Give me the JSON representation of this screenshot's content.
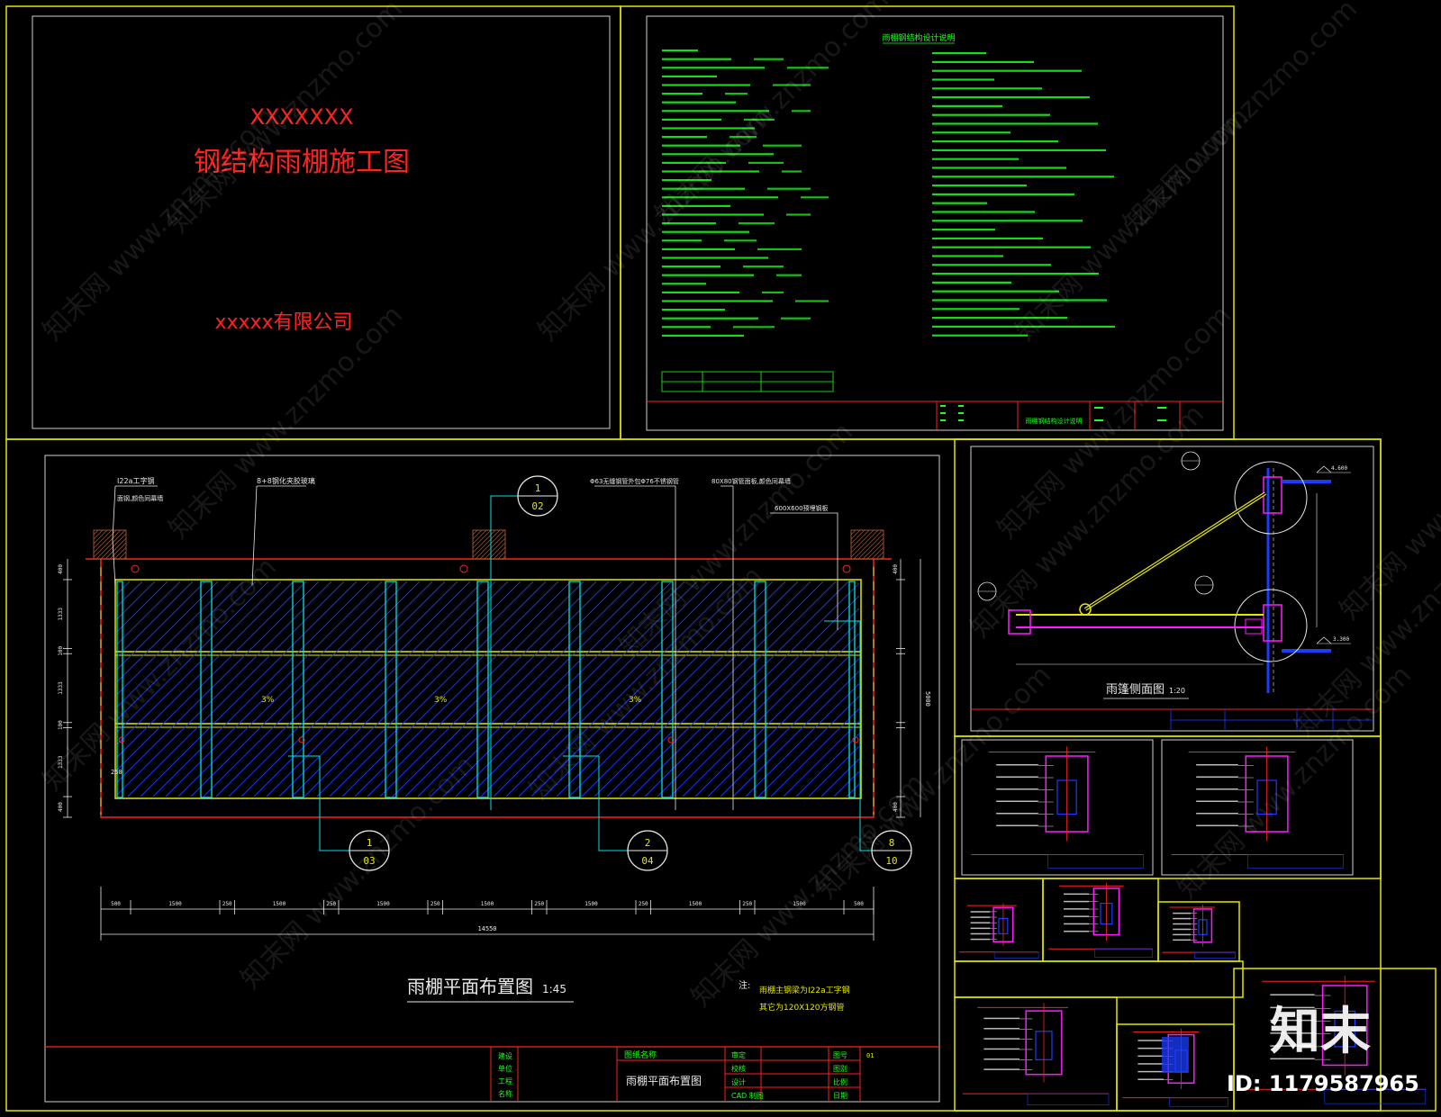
{
  "cover": {
    "project": "XXXXXXX",
    "title": "钢结构雨棚施工图",
    "company": "xxxxx有限公司"
  },
  "spec_sheet": {
    "heading": "雨棚钢结构设计说明",
    "title_block_name": "雨棚钢结构设计说明"
  },
  "plan": {
    "title": "雨棚平面布置图",
    "scale": "1:45",
    "callouts": {
      "beam": "I22a工字钢",
      "beam_note": "面钢,颜色同幕墙",
      "glass": "8+8钢化夹胶玻璃",
      "rod": "Φ63无缝钢管外包Φ76不锈钢管",
      "sq_tube": "80X80钢管面板,颜色同幕墙",
      "embed": "600X600预埋钢板"
    },
    "slope_label": "3%",
    "bubbles": [
      {
        "top": "1",
        "bottom": "02"
      },
      {
        "top": "1",
        "bottom": "03"
      },
      {
        "top": "2",
        "bottom": "04"
      },
      {
        "top": "8",
        "bottom": "10"
      }
    ],
    "dims_bottom": [
      "500",
      "1500",
      "250",
      "1500",
      "250",
      "1500",
      "250",
      "1500",
      "250",
      "1500",
      "250",
      "1500",
      "250",
      "1500",
      "500"
    ],
    "dim_total": "14550",
    "dims_left": [
      "400",
      "1333",
      "100",
      "1333",
      "100",
      "1333",
      "400"
    ],
    "dim_right_total": "5000",
    "dim_250": "250",
    "note_1": "雨棚主钢梁为I22a工字钢",
    "note_2": "其它为120X120方钢管",
    "title_block": {
      "col_a": [
        "建设",
        "单位",
        "工程",
        "名称"
      ],
      "drawing_name_label": "图纸名称",
      "drawing_name": "雨棚平面布置图",
      "roles": [
        "审定",
        "校核",
        "设计",
        "CAD 制图"
      ],
      "meta": [
        "图号",
        "图别",
        "比例",
        "日期"
      ],
      "sheet_no": "01"
    }
  },
  "section": {
    "title": "雨篷侧面图",
    "scale": "1:20",
    "elev_top": "4.600",
    "elev_bottom": "3.300"
  },
  "watermark": {
    "brand": "知末",
    "id_text": "ID: 1179587965",
    "site": "www.znzmo.com",
    "cn": "知末网"
  },
  "colors": {
    "frame": "#e6e600",
    "red": "#ff2020",
    "green": "#1eff1e",
    "cyan": "#00e5e5",
    "blue": "#1a3cff",
    "magenta": "#ff1aff",
    "white": "#e8e8e8",
    "brown": "#a0522d"
  }
}
